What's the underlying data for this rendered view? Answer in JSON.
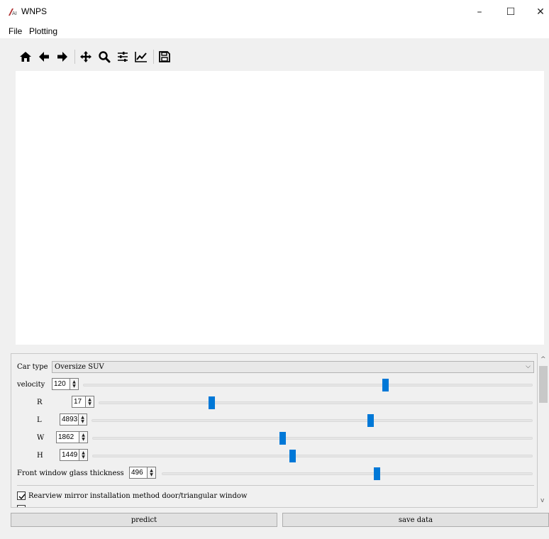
{
  "window": {
    "title": "WNPS",
    "app_icon_glyph": "AI",
    "controls": {
      "minimize": "–",
      "maximize": "☐",
      "close": "✕"
    }
  },
  "menu": {
    "items": [
      "File",
      "Plotting"
    ]
  },
  "toolbar": {
    "icons": [
      "home-icon",
      "back-arrow-icon",
      "forward-arrow-icon",
      "pan-icon",
      "zoom-icon",
      "configure-subplots-icon",
      "edit-axis-icon",
      "save-figure-icon"
    ]
  },
  "controls": {
    "car_type": {
      "label": "Car type",
      "value": "Oversize SUV"
    },
    "sliders": [
      {
        "key": "velocity",
        "label": "velocity",
        "value": "120",
        "level": 0.673
      },
      {
        "key": "R",
        "label": "R",
        "value": "17",
        "level": 0.255
      },
      {
        "key": "L",
        "label": "L",
        "value": "4893",
        "level": 0.633
      },
      {
        "key": "W",
        "label": "W",
        "value": "1862",
        "level": 0.43
      },
      {
        "key": "H",
        "label": "H",
        "value": "1449",
        "level": 0.453
      },
      {
        "key": "front_glass",
        "label": "Front window glass thickness",
        "value": "496",
        "level": 0.58
      }
    ],
    "checkboxes": [
      {
        "label": "Rearview mirror installation method door/triangular window",
        "checked": true
      }
    ]
  },
  "buttons": {
    "predict": "predict",
    "save": "save data"
  },
  "colors": {
    "slider_handle": "#0078d7",
    "panel_background": "#f0f0f0",
    "canvas_background": "#ffffff"
  }
}
